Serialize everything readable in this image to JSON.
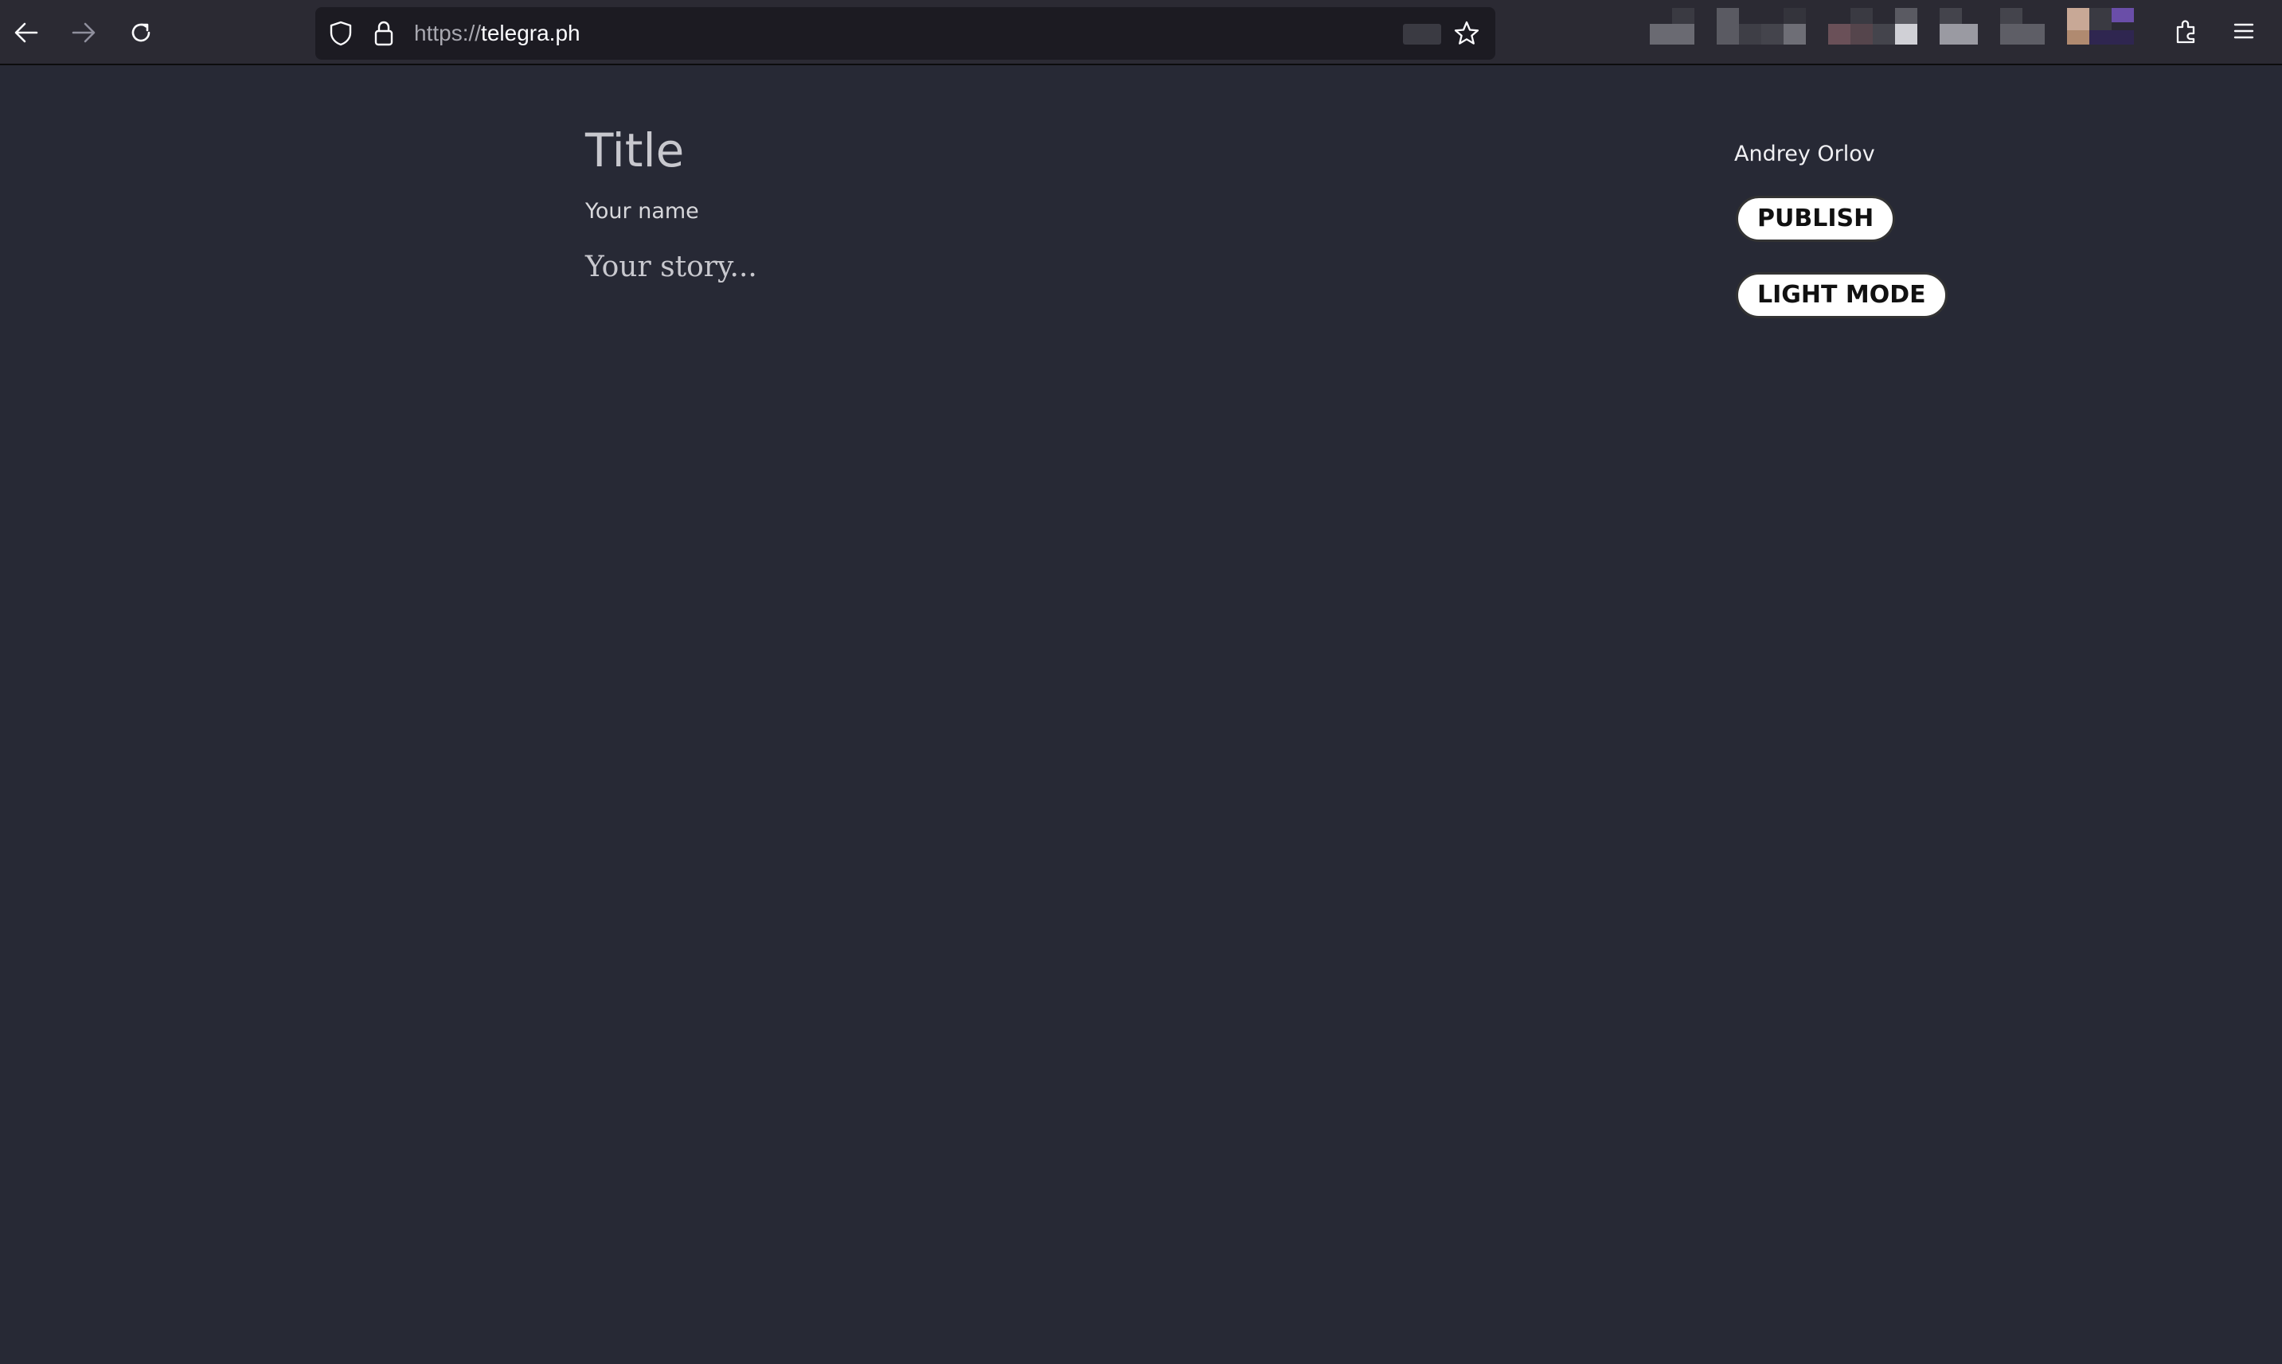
{
  "browser": {
    "url_scheme": "https://",
    "url_host": "telegra.ph",
    "icons": {
      "back": "arrow-left-icon",
      "forward": "arrow-right-icon",
      "reload": "reload-icon",
      "tracking_protection": "shield-icon",
      "security": "lock-icon",
      "bookmark": "star-icon",
      "extensions": "puzzle-icon",
      "menu": "hamburger-menu-icon"
    }
  },
  "editor": {
    "title_placeholder": "Title",
    "author_placeholder": "Your name",
    "story_placeholder": "Your story..."
  },
  "sidebar": {
    "account_name": "Andrey Orlov",
    "publish_label": "PUBLISH",
    "theme_toggle_label": "LIGHT MODE"
  },
  "colors": {
    "page_background": "#272935",
    "toolbar_background": "#2b2a33",
    "urlbar_background": "#1c1b22",
    "button_background": "#ffffff",
    "button_text": "#111111"
  }
}
